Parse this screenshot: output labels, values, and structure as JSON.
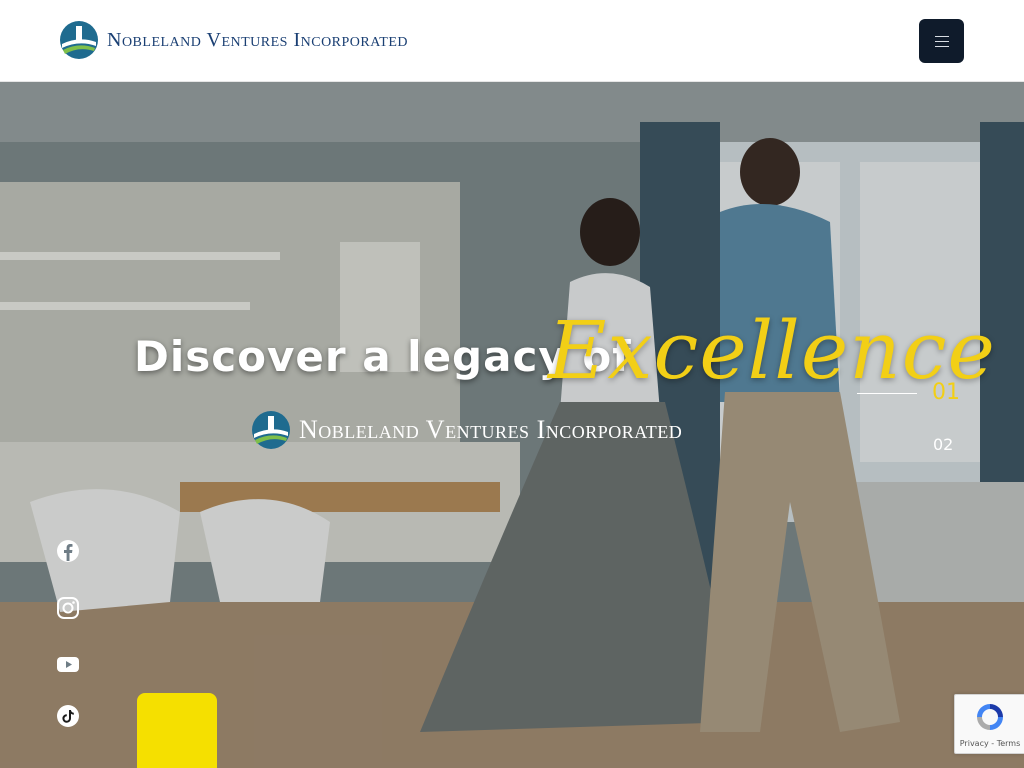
{
  "header": {
    "brand": "Nobleland Ventures Incorporated",
    "menu_icon": "hamburger-icon",
    "menu_button_color": "#0f1b2b"
  },
  "hero": {
    "headline": "Discover a legacy of",
    "script_word": "Excellence",
    "brand": "Nobleland Ventures Incorporated",
    "slides": {
      "current": "01",
      "next": "02"
    },
    "accent_color": "#f2cf16"
  },
  "social": {
    "icons": [
      "facebook-icon",
      "instagram-icon",
      "youtube-icon",
      "tiktok-icon"
    ]
  },
  "recaptcha": {
    "links": "Privacy - Terms"
  }
}
